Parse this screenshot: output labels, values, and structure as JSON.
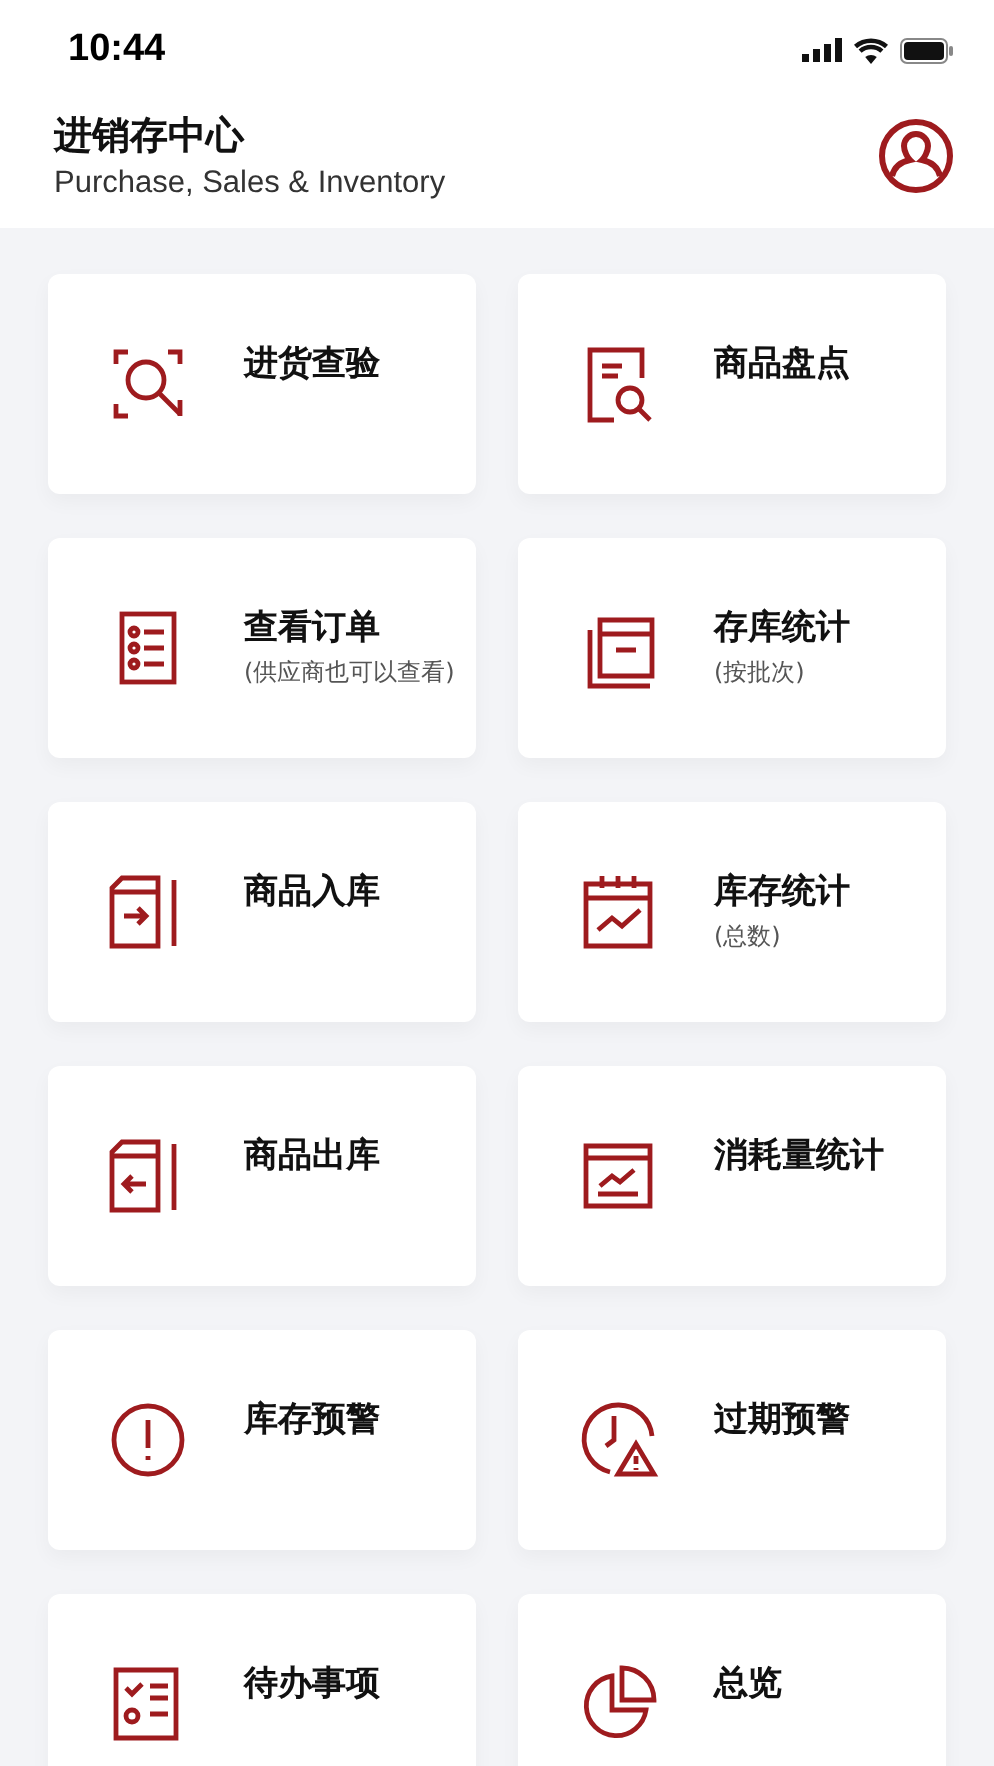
{
  "status_bar": {
    "time": "10:44"
  },
  "header": {
    "title": "进销存中心",
    "subtitle": "Purchase, Sales & Inventory"
  },
  "tiles": [
    {
      "label": "进货查验"
    },
    {
      "label": "商品盘点"
    },
    {
      "label": "查看订单",
      "note": "(供应商也可以查看)"
    },
    {
      "label": "存库统计",
      "note": "(按批次)"
    },
    {
      "label": "商品入库"
    },
    {
      "label": "库存统计",
      "note": "(总数)"
    },
    {
      "label": "商品出库"
    },
    {
      "label": "消耗量统计"
    },
    {
      "label": "库存预警"
    },
    {
      "label": "过期预警"
    },
    {
      "label": "待办事项"
    },
    {
      "label": "总览"
    }
  ]
}
